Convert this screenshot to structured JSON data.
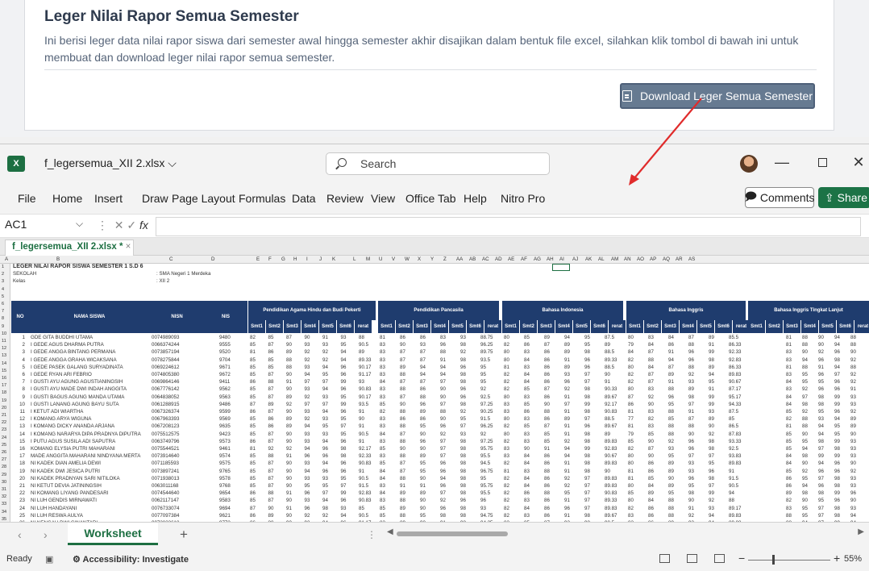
{
  "web": {
    "title": "Leger Nilai Rapor Semua Semester",
    "description": "Ini berisi leger data nilai rapor siswa dari semester awal hingga semester akhir disajikan dalam bentuk file excel, silahkan klik tombol di bawah ini untuk membuat dan download leger nilai rapor semua semester.",
    "download_button": "Download Leger Semua Semester"
  },
  "excel": {
    "filename": "f_legersemua_XII 2.xlsx",
    "search_placeholder": "Search",
    "menu": [
      "File",
      "Home",
      "Insert",
      "Draw",
      "Page Layout",
      "Formulas",
      "Data",
      "Review",
      "View",
      "Office Tab",
      "Help",
      "Nitro Pro"
    ],
    "comments_label": "Comments",
    "share_label": "Share",
    "name_box": "AC1",
    "doc_tab": "f_legersemua_XII 2.xlsx *",
    "sheet_tab": "Worksheet",
    "status_ready": "Ready",
    "status_accessibility": "Accessibility: Investigate",
    "zoom": "55%"
  },
  "spreadsheet": {
    "col_letters": [
      "A",
      "B",
      "C",
      "D",
      "E",
      "F",
      "G",
      "H",
      "I",
      "J",
      "K",
      "L",
      "M",
      "U",
      "V",
      "W",
      "X",
      "Y",
      "Z",
      "AA",
      "AB",
      "AC",
      "AD",
      "AE",
      "AF",
      "AG",
      "AH",
      "AI",
      "AJ",
      "AK",
      "AL",
      "AM",
      "AN",
      "AO",
      "AP",
      "AQ",
      "AR",
      "AS"
    ],
    "title_row": "LEGER NILAI RAPOR SISWA SEMESTER 1 S.D 6",
    "sekolah_label": "SEKOLAH",
    "sekolah_value": ": SMA Negeri 1 Merdeka",
    "kelas_label": "Kelas",
    "kelas_value": ": XII 2",
    "headers": {
      "no": "NO",
      "nama": "NAMA SISWA",
      "nisn": "NISN",
      "nis": "NIS",
      "subjects": [
        "Pendidikan Agama Hindu dan Budi Pekerti",
        "Pendidikan Pancasila",
        "Bahasa Indonesia",
        "Bahasa Inggris",
        "Bahasa Inggris Tingkat Lanjut"
      ],
      "sem_cols": [
        "Smt1",
        "Smt2",
        "Smt3",
        "Smt4",
        "Smt5",
        "Smt6",
        "rerat"
      ]
    },
    "students": [
      {
        "no": "1",
        "name": "GDE GITA BUDDHI UTAMA",
        "nisn": "0074989093",
        "nis": "9480"
      },
      {
        "no": "2",
        "name": "I GEDE AGUS DHARMA PUTRA",
        "nisn": "0066374244",
        "nis": "9555"
      },
      {
        "no": "3",
        "name": "I GEDE ANGGA BINTANG PERMANA",
        "nisn": "0073857194",
        "nis": "9520"
      },
      {
        "no": "4",
        "name": "I GEDE ANGGA GRAHA WICAKSANA",
        "nisn": "0078275844",
        "nis": "9704"
      },
      {
        "no": "5",
        "name": "I GEDE PASEK GALANG SURYADINATA",
        "nisn": "0069224612",
        "nis": "9671"
      },
      {
        "no": "6",
        "name": "I GEDE RYAN ARI FEBRIO",
        "nisn": "0074805380",
        "nis": "9672"
      },
      {
        "no": "7",
        "name": "I GUSTI AYU AGUNG AGUSTIANINGSIH",
        "nisn": "0069864146",
        "nis": "9411"
      },
      {
        "no": "8",
        "name": "I GUSTI AYU MADE DWI INDAH ANGGITA",
        "nisn": "0067776142",
        "nis": "9562"
      },
      {
        "no": "9",
        "name": "I GUSTI BAGUS AGUNG MANDA UTAMA",
        "nisn": "0064838052",
        "nis": "9563"
      },
      {
        "no": "10",
        "name": "I GUSTI LANANG AGUNG BAYU SUTA",
        "nisn": "0061288915",
        "nis": "9486"
      },
      {
        "no": "11",
        "name": "I KETUT ADI WIARTHA",
        "nisn": "0067326374",
        "nis": "9599"
      },
      {
        "no": "12",
        "name": "I KOMANG ARYA WIGUNA",
        "nisn": "0067963393",
        "nis": "9569"
      },
      {
        "no": "13",
        "name": "I KOMANG DICKY ANANDA ARJANA",
        "nisn": "0067208123",
        "nis": "9635"
      },
      {
        "no": "14",
        "name": "I KOMANG NARARYA DIPA PRADNYA DIPUTRA",
        "nisn": "0075512575",
        "nis": "9423"
      },
      {
        "no": "15",
        "name": "I PUTU AGUS SUSILA ADI SAPUTRA",
        "nisn": "0063749796",
        "nis": "9573"
      },
      {
        "no": "16",
        "name": "KOMANG ELYSIA PUTRI MAHARANI",
        "nisn": "0075544521",
        "nis": "9461"
      },
      {
        "no": "17",
        "name": "MADE ANGGITA MAHARANI NINDYANA MERTA",
        "nisn": "0073914640",
        "nis": "9574"
      },
      {
        "no": "18",
        "name": "NI KADEK DIAN AMELIA DEWI",
        "nisn": "0071185593",
        "nis": "9575"
      },
      {
        "no": "19",
        "name": "NI KADEK DWI JESICA PUTRI",
        "nisn": "0073897241",
        "nis": "9765"
      },
      {
        "no": "20",
        "name": "NI KADEK PRADNYAN SARI NITILOKA",
        "nisn": "0071938013",
        "nis": "9578"
      },
      {
        "no": "21",
        "name": "NI KETUT DEVIA JATININGSIH",
        "nisn": "0063011168",
        "nis": "9768"
      },
      {
        "no": "22",
        "name": "NI KOMANG LIYANG PANDESARI",
        "nisn": "0074544640",
        "nis": "9654"
      },
      {
        "no": "23",
        "name": "NI LUH GENDIS MIRNAWATI",
        "nisn": "0062117147",
        "nis": "9583"
      },
      {
        "no": "24",
        "name": "NI LUH HANDAYANI",
        "nisn": "0076733074",
        "nis": "9694"
      },
      {
        "no": "25",
        "name": "NI LUH RESWA AULYA",
        "nisn": "0077097384",
        "nis": "9621"
      },
      {
        "no": "26",
        "name": "NI NENGAH DWI GINANTARI",
        "nisn": "0073833618",
        "nis": "9773"
      },
      {
        "no": "27",
        "name": "NI NYOMAN NOVRIYANTI DIAN PUSPITA",
        "nisn": "0066028051",
        "nis": "9585"
      }
    ],
    "agama": [
      [
        "82",
        "85",
        "87",
        "90",
        "91",
        "93",
        "88"
      ],
      [
        "85",
        "87",
        "90",
        "93",
        "93",
        "95",
        "90.5"
      ],
      [
        "81",
        "86",
        "89",
        "92",
        "92",
        "94",
        "89"
      ],
      [
        "85",
        "85",
        "88",
        "92",
        "92",
        "94",
        "89.33"
      ],
      [
        "85",
        "85",
        "88",
        "93",
        "94",
        "96",
        "90.17"
      ],
      [
        "85",
        "87",
        "90",
        "94",
        "95",
        "96",
        "91.17"
      ],
      [
        "86",
        "88",
        "91",
        "97",
        "97",
        "99",
        "93"
      ],
      [
        "85",
        "87",
        "90",
        "93",
        "94",
        "96",
        "90.83"
      ],
      [
        "85",
        "87",
        "89",
        "92",
        "93",
        "95",
        "90.17"
      ],
      [
        "87",
        "89",
        "92",
        "97",
        "97",
        "99",
        "93.5"
      ],
      [
        "86",
        "87",
        "90",
        "93",
        "94",
        "96",
        "91"
      ],
      [
        "85",
        "86",
        "89",
        "92",
        "93",
        "95",
        "90"
      ],
      [
        "85",
        "86",
        "89",
        "94",
        "95",
        "97",
        "91"
      ],
      [
        "85",
        "87",
        "90",
        "93",
        "93",
        "95",
        "90.5"
      ],
      [
        "86",
        "87",
        "90",
        "93",
        "94",
        "96",
        "91"
      ],
      [
        "81",
        "92",
        "92",
        "94",
        "96",
        "98",
        "92.17"
      ],
      [
        "85",
        "88",
        "91",
        "96",
        "96",
        "98",
        "92.33"
      ],
      [
        "85",
        "87",
        "90",
        "93",
        "94",
        "96",
        "90.83"
      ],
      [
        "85",
        "87",
        "90",
        "94",
        "96",
        "96",
        "91"
      ],
      [
        "85",
        "87",
        "90",
        "93",
        "93",
        "95",
        "90.5"
      ],
      [
        "85",
        "87",
        "90",
        "95",
        "95",
        "97",
        "91.5"
      ],
      [
        "86",
        "88",
        "91",
        "96",
        "97",
        "99",
        "92.83"
      ],
      [
        "85",
        "87",
        "90",
        "93",
        "94",
        "96",
        "90.83"
      ],
      [
        "87",
        "90",
        "91",
        "96",
        "98",
        "93",
        "85"
      ],
      [
        "86",
        "89",
        "90",
        "92",
        "92",
        "94",
        "90.5"
      ],
      [
        "86",
        "88",
        "90",
        "93",
        "94",
        "96",
        "91.17"
      ],
      [
        "85",
        "87",
        "90",
        "93",
        "95",
        "97",
        "91.17"
      ]
    ],
    "pancasila": [
      [
        "81",
        "86",
        "86",
        "83",
        "93",
        "88.75"
      ],
      [
        "83",
        "90",
        "93",
        "96",
        "98",
        "96.25"
      ],
      [
        "83",
        "87",
        "87",
        "88",
        "92",
        "89.75"
      ],
      [
        "83",
        "87",
        "87",
        "91",
        "98",
        "93.5"
      ],
      [
        "83",
        "89",
        "94",
        "94",
        "96",
        "95"
      ],
      [
        "83",
        "88",
        "94",
        "94",
        "98",
        "95"
      ],
      [
        "84",
        "87",
        "87",
        "97",
        "98",
        "95"
      ],
      [
        "83",
        "88",
        "86",
        "90",
        "96",
        "92"
      ],
      [
        "83",
        "87",
        "88",
        "90",
        "96",
        "92.5"
      ],
      [
        "85",
        "90",
        "96",
        "97",
        "98",
        "97.25"
      ],
      [
        "82",
        "88",
        "89",
        "88",
        "92",
        "90.25"
      ],
      [
        "83",
        "86",
        "86",
        "90",
        "95",
        "91.5"
      ],
      [
        "83",
        "88",
        "95",
        "96",
        "97",
        "96.25"
      ],
      [
        "84",
        "87",
        "90",
        "92",
        "93",
        "92"
      ],
      [
        "83",
        "88",
        "96",
        "97",
        "98",
        "97.25"
      ],
      [
        "85",
        "90",
        "90",
        "97",
        "98",
        "95.75"
      ],
      [
        "83",
        "88",
        "89",
        "97",
        "98",
        "95.5"
      ],
      [
        "85",
        "87",
        "95",
        "96",
        "98",
        "94.5"
      ],
      [
        "84",
        "87",
        "95",
        "96",
        "98",
        "96.75"
      ],
      [
        "84",
        "88",
        "90",
        "94",
        "98",
        "95"
      ],
      [
        "83",
        "91",
        "91",
        "96",
        "98",
        "95.75"
      ],
      [
        "84",
        "89",
        "89",
        "97",
        "98",
        "95.5"
      ],
      [
        "83",
        "88",
        "90",
        "92",
        "96",
        "96"
      ],
      [
        "85",
        "89",
        "90",
        "96",
        "98",
        "93"
      ],
      [
        "85",
        "88",
        "95",
        "98",
        "98",
        "94.75"
      ],
      [
        "83",
        "89",
        "90",
        "91",
        "98",
        "94.25"
      ],
      [
        "84",
        "88",
        "95",
        "96",
        "98",
        "96.75"
      ]
    ],
    "indonesia": [
      [
        "80",
        "85",
        "89",
        "94",
        "95",
        "87.5"
      ],
      [
        "82",
        "86",
        "87",
        "89",
        "95",
        "89"
      ],
      [
        "80",
        "83",
        "86",
        "89",
        "98",
        "88.5"
      ],
      [
        "80",
        "84",
        "86",
        "91",
        "96",
        "89.33"
      ],
      [
        "81",
        "83",
        "86",
        "89",
        "96",
        "88.5"
      ],
      [
        "82",
        "84",
        "86",
        "93",
        "97",
        "90"
      ],
      [
        "82",
        "84",
        "86",
        "96",
        "97",
        "91"
      ],
      [
        "82",
        "85",
        "87",
        "92",
        "98",
        "90.33"
      ],
      [
        "80",
        "83",
        "86",
        "91",
        "98",
        "89.67"
      ],
      [
        "83",
        "85",
        "90",
        "97",
        "99",
        "92.17"
      ],
      [
        "83",
        "86",
        "88",
        "91",
        "98",
        "90.83"
      ],
      [
        "80",
        "83",
        "86",
        "89",
        "97",
        "88.5"
      ],
      [
        "82",
        "85",
        "87",
        "91",
        "96",
        "89.67"
      ],
      [
        "80",
        "83",
        "85",
        "91",
        "98",
        "89"
      ],
      [
        "82",
        "83",
        "85",
        "92",
        "98",
        "89.83"
      ],
      [
        "83",
        "90",
        "91",
        "94",
        "99",
        "92.83"
      ],
      [
        "83",
        "84",
        "86",
        "94",
        "98",
        "90.67"
      ],
      [
        "82",
        "84",
        "86",
        "91",
        "98",
        "89.83"
      ],
      [
        "81",
        "83",
        "88",
        "91",
        "98",
        "90"
      ],
      [
        "82",
        "84",
        "86",
        "92",
        "97",
        "89.83"
      ],
      [
        "82",
        "84",
        "86",
        "92",
        "97",
        "89.83"
      ],
      [
        "82",
        "86",
        "88",
        "95",
        "97",
        "90.83"
      ],
      [
        "82",
        "83",
        "86",
        "91",
        "97",
        "89.33"
      ],
      [
        "82",
        "84",
        "86",
        "96",
        "97",
        "89.83"
      ],
      [
        "82",
        "83",
        "86",
        "91",
        "98",
        "89.67"
      ],
      [
        "83",
        "85",
        "87",
        "92",
        "98",
        "90.5"
      ],
      [
        "82",
        "83",
        "86",
        "91",
        "98",
        "89.67"
      ]
    ],
    "inggris": [
      [
        "80",
        "83",
        "84",
        "87",
        "89",
        "85.5"
      ],
      [
        "79",
        "84",
        "86",
        "88",
        "91",
        "86.33"
      ],
      [
        "84",
        "87",
        "91",
        "96",
        "99",
        "92.33"
      ],
      [
        "82",
        "88",
        "94",
        "96",
        "98",
        "92.83"
      ],
      [
        "80",
        "84",
        "87",
        "88",
        "89",
        "86.33"
      ],
      [
        "82",
        "87",
        "89",
        "92",
        "94",
        "89.83"
      ],
      [
        "82",
        "87",
        "91",
        "93",
        "95",
        "90.67"
      ],
      [
        "80",
        "83",
        "88",
        "89",
        "91",
        "87.17"
      ],
      [
        "87",
        "92",
        "96",
        "98",
        "99",
        "95.17"
      ],
      [
        "86",
        "90",
        "95",
        "97",
        "99",
        "94.33"
      ],
      [
        "81",
        "83",
        "88",
        "91",
        "93",
        "87.5"
      ],
      [
        "77",
        "82",
        "85",
        "87",
        "89",
        "85"
      ],
      [
        "81",
        "83",
        "88",
        "88",
        "90",
        "86.5"
      ],
      [
        "79",
        "85",
        "88",
        "90",
        "92",
        "87.83"
      ],
      [
        "85",
        "90",
        "92",
        "96",
        "98",
        "93.33"
      ],
      [
        "82",
        "87",
        "93",
        "96",
        "98",
        "92.5"
      ],
      [
        "80",
        "90",
        "95",
        "97",
        "97",
        "93.83"
      ],
      [
        "80",
        "86",
        "89",
        "93",
        "95",
        "89.83"
      ],
      [
        "81",
        "86",
        "89",
        "93",
        "96",
        "91"
      ],
      [
        "81",
        "85",
        "90",
        "96",
        "98",
        "91.5"
      ],
      [
        "80",
        "84",
        "89",
        "95",
        "97",
        "90.5"
      ],
      [
        "85",
        "89",
        "95",
        "98",
        "99",
        "94"
      ],
      [
        "80",
        "84",
        "88",
        "90",
        "92",
        "88"
      ],
      [
        "82",
        "86",
        "88",
        "91",
        "93",
        "89.17"
      ],
      [
        "83",
        "86",
        "88",
        "92",
        "94",
        "89.83"
      ],
      [
        "82",
        "86",
        "89",
        "93",
        "94",
        "89.83"
      ],
      [
        "82",
        "86",
        "89",
        "92",
        "95",
        "90.33"
      ]
    ],
    "inggris_lanjut": [
      [
        "81",
        "88",
        "90",
        "94",
        "88"
      ],
      [
        "81",
        "88",
        "90",
        "94",
        "88"
      ],
      [
        "83",
        "90",
        "92",
        "96",
        "90"
      ],
      [
        "83",
        "94",
        "96",
        "98",
        "92"
      ],
      [
        "81",
        "88",
        "91",
        "94",
        "88"
      ],
      [
        "83",
        "95",
        "96",
        "97",
        "92"
      ],
      [
        "84",
        "95",
        "95",
        "96",
        "92"
      ],
      [
        "83",
        "92",
        "96",
        "96",
        "91"
      ],
      [
        "84",
        "97",
        "98",
        "99",
        "93"
      ],
      [
        "84",
        "98",
        "98",
        "99",
        "93"
      ],
      [
        "85",
        "92",
        "95",
        "96",
        "92"
      ],
      [
        "82",
        "88",
        "93",
        "94",
        "89"
      ],
      [
        "81",
        "88",
        "94",
        "95",
        "89"
      ],
      [
        "85",
        "90",
        "94",
        "95",
        "90"
      ],
      [
        "85",
        "95",
        "98",
        "99",
        "93"
      ],
      [
        "85",
        "94",
        "97",
        "98",
        "93"
      ],
      [
        "84",
        "98",
        "99",
        "99",
        "93"
      ],
      [
        "84",
        "90",
        "94",
        "96",
        "90"
      ],
      [
        "85",
        "92",
        "96",
        "96",
        "92"
      ],
      [
        "86",
        "95",
        "97",
        "98",
        "93"
      ],
      [
        "86",
        "94",
        "96",
        "98",
        "93"
      ],
      [
        "89",
        "98",
        "98",
        "99",
        "96"
      ],
      [
        "82",
        "90",
        "95",
        "96",
        "90"
      ],
      [
        "83",
        "95",
        "97",
        "98",
        "93"
      ],
      [
        "88",
        "95",
        "97",
        "98",
        "94"
      ],
      [
        "88",
        "94",
        "97",
        "99",
        "94"
      ],
      [
        "81",
        "92",
        "96",
        "99",
        "94"
      ]
    ]
  }
}
